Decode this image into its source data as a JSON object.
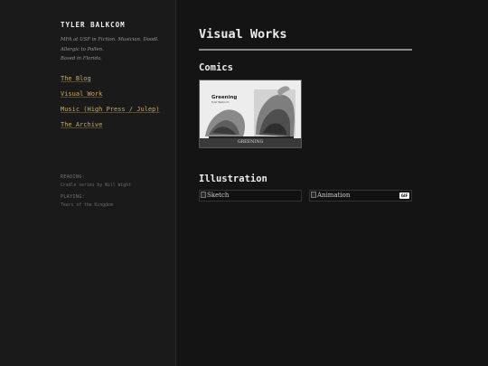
{
  "sidebar": {
    "site_title": "TYLER BALKCOM",
    "bio": [
      "MFA at USF in Fiction. Musician. Doodl.",
      "Allergic to Pollen.",
      "Based in Florida."
    ],
    "nav": [
      {
        "label": "The Blog"
      },
      {
        "label": "Visual Work"
      },
      {
        "label": "Music (High Press / Julep)"
      },
      {
        "label": "The Archive"
      }
    ],
    "reading": {
      "label": "READING:",
      "value": "Cradle series by Will Wight"
    },
    "playing": {
      "label": "PLAYING:",
      "value": "Tears of the Kingdom"
    }
  },
  "main": {
    "title": "Visual Works",
    "sections": {
      "comics": {
        "heading": "Comics",
        "items": [
          {
            "cover_title": "Greening",
            "cover_subtitle": "Tyler Balkcom",
            "caption": "GREENING"
          }
        ]
      },
      "illustration": {
        "heading": "Illustration",
        "items": [
          {
            "alt": "Sketch"
          },
          {
            "alt": "Animation",
            "badge": "GIF"
          }
        ]
      }
    }
  },
  "colors": {
    "background": "#141414",
    "sidebar": "#1a1a1a",
    "link": "#c9a86a",
    "text": "#ececec"
  }
}
